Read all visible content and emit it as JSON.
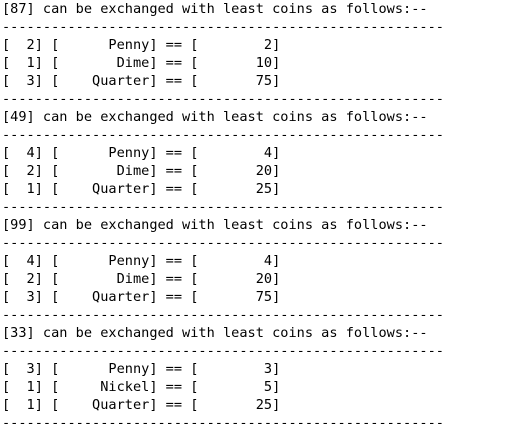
{
  "blocks": [
    {
      "header": "[87] can be exchanged with least coins as follows:--",
      "separator_top": "------------------------------------------------------",
      "rows": [
        "[  2] [      Penny] == [        2]",
        "[  1] [       Dime] == [       10]",
        "[  3] [    Quarter] == [       75]"
      ],
      "separator_bottom": "------------------------------------------------------"
    },
    {
      "header": "[49] can be exchanged with least coins as follows:--",
      "separator_top": "------------------------------------------------------",
      "rows": [
        "[  4] [      Penny] == [        4]",
        "[  2] [       Dime] == [       20]",
        "[  1] [    Quarter] == [       25]"
      ],
      "separator_bottom": "------------------------------------------------------"
    },
    {
      "header": "[99] can be exchanged with least coins as follows:--",
      "separator_top": "------------------------------------------------------",
      "rows": [
        "[  4] [      Penny] == [        4]",
        "[  2] [       Dime] == [       20]",
        "[  3] [    Quarter] == [       75]"
      ],
      "separator_bottom": "------------------------------------------------------"
    },
    {
      "header": "[33] can be exchanged with least coins as follows:--",
      "separator_top": "------------------------------------------------------",
      "rows": [
        "[  3] [      Penny] == [        3]",
        "[  1] [     Nickel] == [        5]",
        "[  1] [    Quarter] == [       25]"
      ],
      "separator_bottom": "------------------------------------------------------"
    }
  ]
}
